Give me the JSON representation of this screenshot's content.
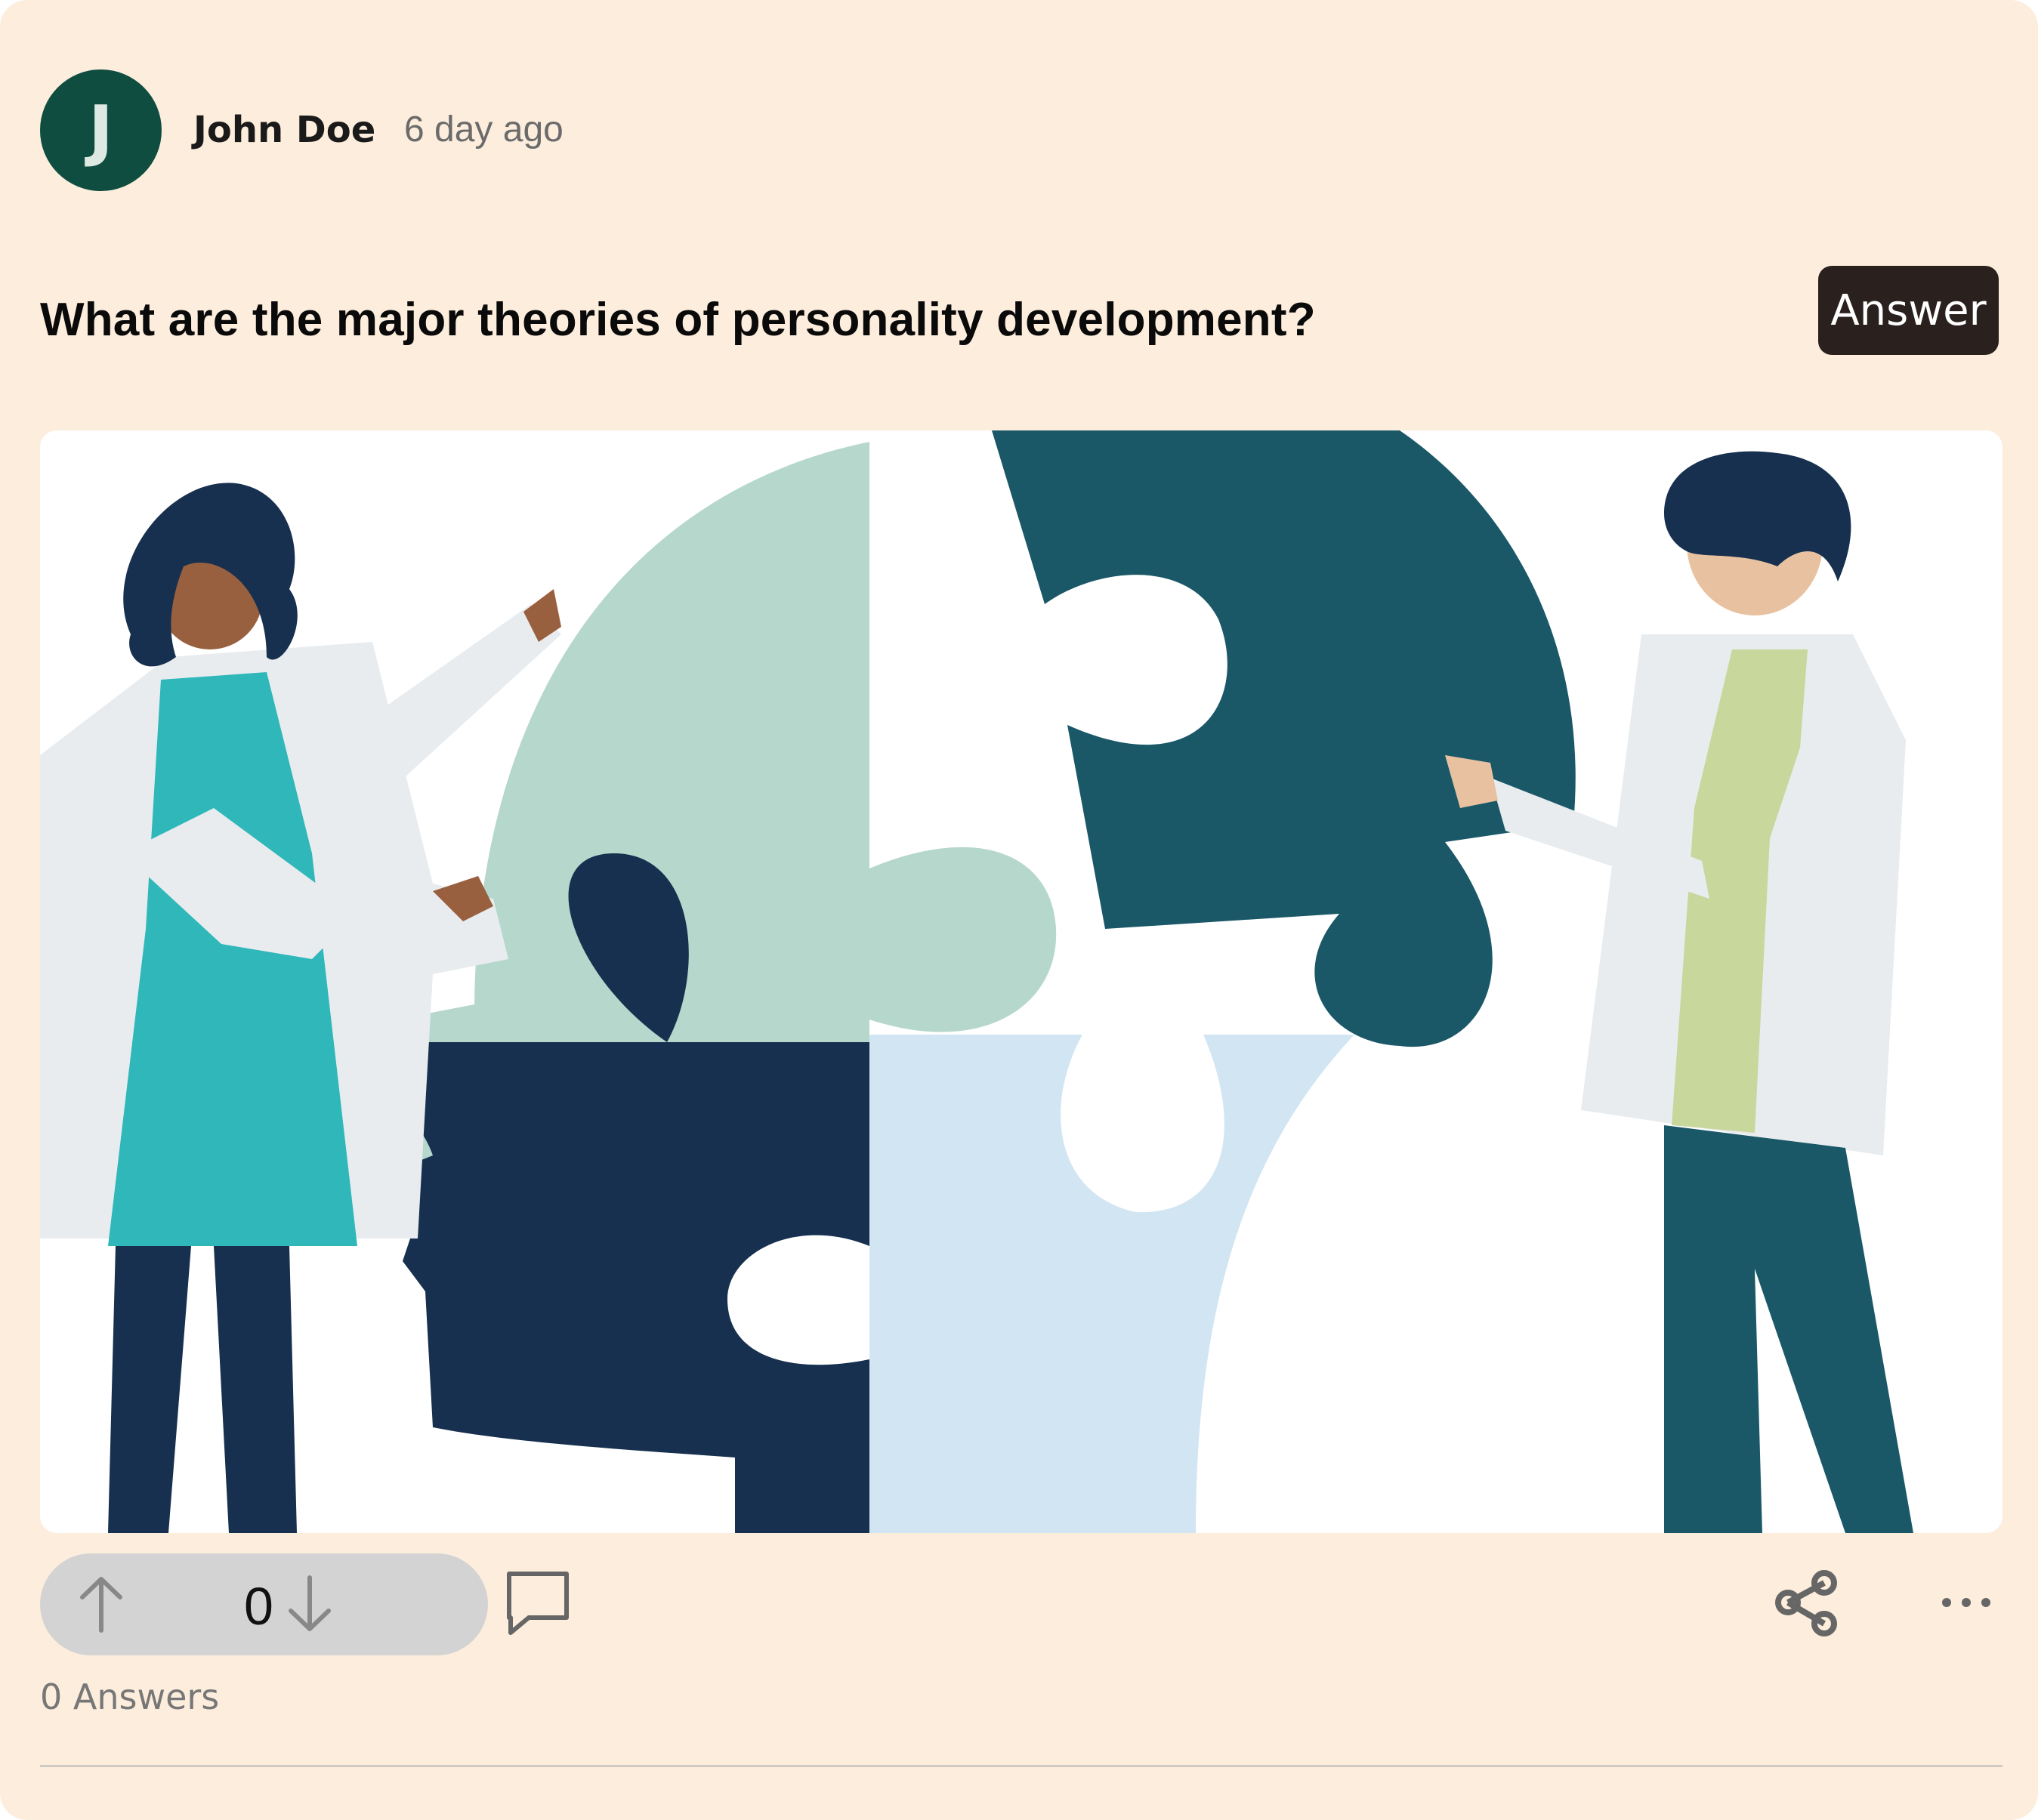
{
  "post": {
    "avatar_initial": "J",
    "author": "John Doe",
    "time": "6 day ago",
    "question": "What are the major theories of personality development?",
    "answer_button": "Answer",
    "vote_count": "0",
    "answers_count": "0 Answers"
  },
  "icons": {
    "upvote": "arrow-up-icon",
    "downvote": "arrow-down-icon",
    "comment": "comment-icon",
    "share": "share-icon",
    "more": "more-horizontal-icon"
  },
  "colors": {
    "card_background": "#fdeddc",
    "avatar": "#0e4d3f",
    "answer_button": "#2a211e",
    "vote_pill": "#d3d3d3"
  }
}
